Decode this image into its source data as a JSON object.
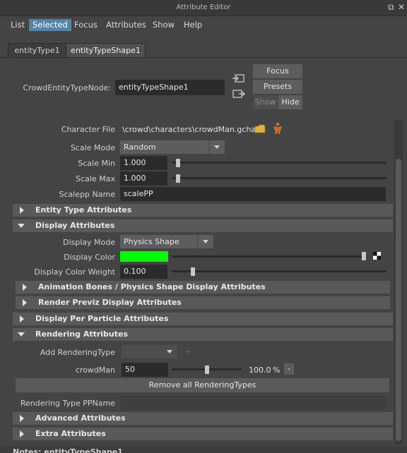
{
  "window": {
    "title": "Attribute Editor"
  },
  "menubar": [
    "List",
    "Selected",
    "Focus",
    "Attributes",
    "Show",
    "Help"
  ],
  "tabs": [
    "entityType1",
    "entityTypeShape1"
  ],
  "node": {
    "label": "CrowdEntityTypeNode:",
    "value": "entityTypeShape1"
  },
  "buttons": {
    "focus": "Focus",
    "presets": "Presets",
    "show": "Show",
    "hide": "Hide"
  },
  "character_file": {
    "label": "Character File",
    "value": "\\crowd\\characters\\crowdMan.gcha"
  },
  "scale_mode": {
    "label": "Scale Mode",
    "value": "Random"
  },
  "scale_min": {
    "label": "Scale Min",
    "value": "1.000",
    "slider": 0.03
  },
  "scale_max": {
    "label": "Scale Max",
    "value": "1.000",
    "slider": 0.03
  },
  "scalepp": {
    "label": "Scalepp Name",
    "value": "scalePP"
  },
  "sections": {
    "entity_type": "Entity Type Attributes",
    "display": "Display Attributes",
    "anim_bones": "Animation Bones / Physics Shape Display Attributes",
    "render_previz": "Render Previz Display Attributes",
    "per_particle": "Display Per Particle Attributes",
    "rendering": "Rendering Attributes",
    "advanced": "Advanced Attributes",
    "extra": "Extra Attributes"
  },
  "display_mode": {
    "label": "Display Mode",
    "value": "Physics Shape"
  },
  "display_color": {
    "label": "Display Color",
    "color": "#00ff00"
  },
  "display_color_weight": {
    "label": "Display Color Weight",
    "value": "0.100",
    "slider": 0.1
  },
  "add_rendering_type": {
    "label": "Add RenderingType",
    "value": "",
    "plus": "+"
  },
  "crowdman": {
    "label": "crowdMan",
    "value": "50",
    "slider": 0.5,
    "percent": "100.0",
    "unit": "%",
    "minus": "-"
  },
  "remove_all": "Remove all RenderingTypes",
  "rendering_pp": {
    "label": "Rendering Type PPName",
    "value": ""
  },
  "footer": "Notes: entityTypeShape1"
}
